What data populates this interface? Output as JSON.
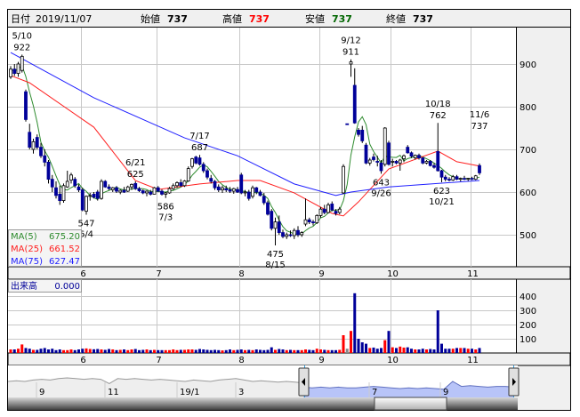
{
  "header": {
    "date_label": "日付",
    "date_value": "2019/11/07",
    "open_label": "始値",
    "open_value": "737",
    "high_label": "高値",
    "high_value": "737",
    "low_label": "安値",
    "low_value": "737",
    "close_label": "終値",
    "close_value": "737"
  },
  "legend": {
    "ma5": {
      "label": "MA(5)",
      "value": "675.20",
      "color": "#2e8b2e"
    },
    "ma25": {
      "label": "MA(25)",
      "value": "661.52",
      "color": "#ff2020"
    },
    "ma75": {
      "label": "MA(75)",
      "value": "627.47",
      "color": "#2020ff"
    },
    "volume": {
      "label": "出来高",
      "value": "0.000"
    }
  },
  "colors": {
    "up_volume": "#ff0000",
    "down_volume": "#000099",
    "flat_volume": "#888888",
    "down_body": "#000099",
    "up_body": "#ffffff",
    "grid": "#c8c8c8",
    "nav_fill": "#b8c4f8"
  },
  "chart_data": {
    "type": "candlestick",
    "price_axis": {
      "ticks": [
        "900",
        "800",
        "700",
        "600",
        "500"
      ],
      "range": [
        440,
        990
      ]
    },
    "volume_axis": {
      "ticks": [
        "400",
        "300",
        "200",
        "100"
      ],
      "range": [
        0,
        500
      ]
    },
    "month_labels": [
      {
        "date": "6/3",
        "label": "6"
      },
      {
        "date": "7/1",
        "label": "7"
      },
      {
        "date": "8/1",
        "label": "8"
      },
      {
        "date": "9/2",
        "label": "9"
      },
      {
        "date": "10/1",
        "label": "10"
      },
      {
        "date": "11/1",
        "label": "11"
      }
    ],
    "candles": [
      [
        "5/7",
        870,
        895,
        865,
        888,
        25
      ],
      [
        "5/8",
        888,
        900,
        872,
        878,
        25
      ],
      [
        "5/9",
        878,
        905,
        870,
        900,
        30
      ],
      [
        "5/10",
        885,
        922,
        880,
        918,
        60
      ],
      [
        "5/13",
        835,
        840,
        765,
        770,
        35
      ],
      [
        "5/14",
        740,
        760,
        700,
        705,
        30
      ],
      [
        "5/15",
        700,
        725,
        690,
        718,
        22
      ],
      [
        "5/16",
        728,
        735,
        700,
        705,
        22
      ],
      [
        "5/17",
        705,
        715,
        680,
        685,
        30
      ],
      [
        "5/20",
        685,
        700,
        660,
        670,
        35
      ],
      [
        "5/21",
        670,
        675,
        620,
        630,
        25
      ],
      [
        "5/22",
        630,
        640,
        600,
        612,
        30
      ],
      [
        "5/23",
        610,
        625,
        585,
        592,
        20
      ],
      [
        "5/24",
        595,
        615,
        570,
        580,
        25
      ],
      [
        "5/27",
        580,
        620,
        575,
        615,
        20
      ],
      [
        "5/28",
        612,
        650,
        610,
        625,
        20
      ],
      [
        "5/29",
        628,
        645,
        620,
        640,
        25
      ],
      [
        "5/30",
        630,
        635,
        610,
        615,
        20
      ],
      [
        "5/31",
        612,
        618,
        600,
        605,
        25
      ],
      [
        "6/3",
        605,
        610,
        555,
        558,
        30
      ],
      [
        "6/4",
        555,
        592,
        547,
        590,
        32
      ],
      [
        "6/5",
        590,
        598,
        580,
        592,
        28
      ],
      [
        "6/6",
        595,
        600,
        585,
        588,
        26
      ],
      [
        "6/7",
        600,
        605,
        580,
        585,
        28
      ],
      [
        "6/10",
        585,
        630,
        582,
        625,
        25
      ],
      [
        "6/11",
        625,
        628,
        610,
        612,
        22
      ],
      [
        "6/12",
        612,
        618,
        605,
        608,
        28
      ],
      [
        "6/13",
        605,
        612,
        600,
        610,
        25
      ],
      [
        "6/14",
        610,
        614,
        598,
        602,
        20
      ],
      [
        "6/17",
        600,
        606,
        595,
        604,
        22
      ],
      [
        "6/18",
        604,
        612,
        598,
        600,
        25
      ],
      [
        "6/19",
        602,
        615,
        600,
        612,
        20
      ],
      [
        "6/20",
        612,
        620,
        605,
        618,
        25
      ],
      [
        "6/21",
        620,
        625,
        605,
        608,
        28
      ],
      [
        "6/24",
        608,
        612,
        600,
        603,
        20
      ],
      [
        "6/25",
        603,
        606,
        595,
        598,
        22
      ],
      [
        "6/26",
        598,
        604,
        590,
        602,
        25
      ],
      [
        "6/27",
        600,
        605,
        592,
        595,
        20
      ],
      [
        "6/28",
        595,
        612,
        595,
        610,
        22
      ],
      [
        "7/1",
        610,
        614,
        600,
        602,
        20
      ],
      [
        "7/2",
        602,
        606,
        592,
        595,
        20
      ],
      [
        "7/3",
        595,
        600,
        586,
        598,
        20
      ],
      [
        "7/4",
        598,
        612,
        596,
        608,
        20
      ],
      [
        "7/5",
        608,
        620,
        605,
        615,
        25
      ],
      [
        "7/8",
        615,
        625,
        610,
        622,
        20
      ],
      [
        "7/9",
        622,
        630,
        612,
        615,
        22
      ],
      [
        "7/10",
        615,
        628,
        612,
        626,
        22
      ],
      [
        "7/11",
        626,
        660,
        624,
        655,
        25
      ],
      [
        "7/12",
        660,
        680,
        655,
        678,
        25
      ],
      [
        "7/16",
        682,
        685,
        665,
        668,
        22
      ],
      [
        "7/17",
        680,
        687,
        662,
        665,
        28
      ],
      [
        "7/18",
        665,
        670,
        645,
        650,
        25
      ],
      [
        "7/19",
        650,
        655,
        630,
        635,
        22
      ],
      [
        "7/22",
        632,
        640,
        620,
        625,
        20
      ],
      [
        "7/23",
        625,
        628,
        605,
        610,
        22
      ],
      [
        "7/24",
        612,
        618,
        600,
        605,
        20
      ],
      [
        "7/25",
        605,
        615,
        598,
        610,
        18
      ],
      [
        "7/26",
        608,
        615,
        600,
        605,
        20
      ],
      [
        "7/29",
        605,
        612,
        598,
        602,
        25
      ],
      [
        "7/30",
        602,
        610,
        596,
        608,
        20
      ],
      [
        "7/31",
        606,
        612,
        598,
        600,
        22
      ],
      [
        "8/1",
        640,
        645,
        595,
        598,
        25
      ],
      [
        "8/2",
        598,
        605,
        590,
        600,
        20
      ],
      [
        "8/5",
        600,
        605,
        580,
        585,
        22
      ],
      [
        "8/6",
        590,
        615,
        585,
        610,
        20
      ],
      [
        "8/7",
        610,
        612,
        595,
        600,
        25
      ],
      [
        "8/8",
        600,
        605,
        590,
        592,
        22
      ],
      [
        "8/9",
        590,
        598,
        570,
        575,
        20
      ],
      [
        "8/13",
        575,
        580,
        545,
        548,
        22
      ],
      [
        "8/14",
        555,
        560,
        510,
        515,
        40
      ],
      [
        "8/15",
        515,
        540,
        475,
        530,
        22
      ],
      [
        "8/16",
        530,
        545,
        500,
        505,
        28
      ],
      [
        "8/19",
        505,
        512,
        492,
        496,
        25
      ],
      [
        "8/20",
        496,
        505,
        490,
        500,
        20
      ],
      [
        "8/21",
        500,
        510,
        495,
        498,
        22
      ],
      [
        "8/22",
        498,
        515,
        490,
        510,
        20
      ],
      [
        "8/23",
        510,
        520,
        495,
        500,
        20
      ],
      [
        "8/26",
        500,
        508,
        495,
        505,
        20
      ],
      [
        "8/27",
        525,
        585,
        520,
        535,
        25
      ],
      [
        "8/28",
        535,
        540,
        525,
        530,
        22
      ],
      [
        "8/29",
        530,
        535,
        522,
        528,
        20
      ],
      [
        "8/30",
        528,
        548,
        525,
        545,
        30
      ],
      [
        "9/2",
        545,
        565,
        540,
        560,
        25
      ],
      [
        "9/3",
        560,
        570,
        548,
        552,
        22
      ],
      [
        "9/4",
        552,
        575,
        550,
        570,
        20
      ],
      [
        "9/5",
        572,
        578,
        555,
        558,
        20
      ],
      [
        "9/6",
        555,
        560,
        545,
        550,
        20
      ],
      [
        "9/9",
        552,
        565,
        548,
        560,
        22
      ],
      [
        "9/10",
        598,
        665,
        595,
        660,
        125
      ],
      [
        "9/11",
        760,
        760,
        760,
        760,
        30
      ],
      [
        "9/12",
        900,
        911,
        870,
        905,
        155
      ],
      [
        "9/13",
        850,
        890,
        760,
        762,
        420
      ],
      [
        "9/17",
        745,
        750,
        730,
        735,
        100
      ],
      [
        "9/18",
        745,
        755,
        715,
        720,
        75
      ],
      [
        "9/19",
        710,
        715,
        665,
        668,
        65
      ],
      [
        "9/20",
        668,
        680,
        662,
        675,
        35
      ],
      [
        "9/24",
        682,
        690,
        672,
        676,
        38
      ],
      [
        "9/25",
        672,
        685,
        660,
        670,
        30
      ],
      [
        "9/26",
        668,
        675,
        643,
        650,
        35
      ],
      [
        "9/27",
        665,
        752,
        660,
        750,
        90
      ],
      [
        "9/30",
        715,
        720,
        662,
        665,
        155
      ],
      [
        "10/1",
        670,
        678,
        660,
        672,
        40
      ],
      [
        "10/2",
        672,
        675,
        665,
        668,
        35
      ],
      [
        "10/3",
        668,
        678,
        650,
        675,
        45
      ],
      [
        "10/4",
        678,
        688,
        670,
        685,
        38
      ],
      [
        "10/7",
        705,
        710,
        690,
        692,
        40
      ],
      [
        "10/8",
        692,
        695,
        680,
        684,
        30
      ],
      [
        "10/9",
        680,
        688,
        676,
        686,
        25
      ],
      [
        "10/10",
        686,
        690,
        676,
        680,
        25
      ],
      [
        "10/11",
        680,
        682,
        665,
        668,
        30
      ],
      [
        "10/15",
        668,
        675,
        665,
        672,
        25
      ],
      [
        "10/16",
        672,
        675,
        660,
        662,
        28
      ],
      [
        "10/17",
        662,
        668,
        655,
        658,
        25
      ],
      [
        "10/18",
        695,
        762,
        648,
        650,
        300
      ],
      [
        "10/21",
        650,
        652,
        623,
        635,
        65
      ],
      [
        "10/23",
        635,
        640,
        625,
        630,
        30
      ],
      [
        "10/24",
        630,
        635,
        625,
        628,
        30
      ],
      [
        "10/25",
        628,
        640,
        626,
        636,
        30
      ],
      [
        "10/28",
        636,
        640,
        628,
        630,
        35
      ],
      [
        "10/29",
        630,
        634,
        625,
        632,
        35
      ],
      [
        "10/30",
        632,
        638,
        628,
        630,
        35
      ],
      [
        "10/31",
        630,
        633,
        626,
        632,
        30
      ],
      [
        "11/1",
        632,
        636,
        628,
        630,
        30
      ],
      [
        "11/5",
        630,
        640,
        628,
        638,
        25
      ],
      [
        "11/6",
        662,
        667,
        640,
        645,
        35
      ]
    ],
    "ma25_points": [
      [
        0,
        873
      ],
      [
        5,
        856
      ],
      [
        22,
        752
      ],
      [
        33,
        627
      ],
      [
        39,
        606
      ],
      [
        50,
        619
      ],
      [
        60,
        627
      ],
      [
        66,
        627
      ],
      [
        75,
        598
      ],
      [
        85,
        550
      ],
      [
        88,
        544
      ],
      [
        92,
        577
      ],
      [
        100,
        654
      ],
      [
        113,
        696
      ],
      [
        118,
        671
      ],
      [
        124,
        661
      ]
    ],
    "ma75_points": [
      [
        0,
        927
      ],
      [
        22,
        821
      ],
      [
        46,
        727
      ],
      [
        60,
        685
      ],
      [
        75,
        619
      ],
      [
        86,
        592
      ],
      [
        90,
        600
      ],
      [
        100,
        612
      ],
      [
        124,
        627
      ]
    ],
    "annotations": [
      {
        "date": "5/10",
        "value": "922",
        "pos": "above"
      },
      {
        "date": "6/4",
        "value": "547",
        "pos": "below"
      },
      {
        "date": "6/21",
        "value": "625",
        "pos": "above"
      },
      {
        "date": "7/3",
        "value": "586",
        "pos": "below"
      },
      {
        "date": "7/17",
        "value": "687",
        "pos": "above"
      },
      {
        "date": "8/15",
        "value": "475",
        "pos": "below"
      },
      {
        "date": "9/12",
        "value": "911",
        "pos": "above"
      },
      {
        "date": "9/26",
        "value": "643",
        "pos": "below"
      },
      {
        "date": "10/18",
        "value": "762",
        "pos": "above"
      },
      {
        "date": "10/21",
        "value": "623",
        "pos": "below"
      },
      {
        "date": "11/6",
        "value": "737",
        "pos": "above"
      }
    ]
  },
  "navigator": {
    "labels": [
      "9",
      "11",
      "19/1",
      "3",
      "7",
      "9"
    ],
    "history": [
      40,
      41,
      40,
      42,
      43,
      42,
      44,
      45,
      44,
      43,
      44,
      43,
      37,
      44,
      43,
      44,
      43,
      42,
      43,
      42,
      41,
      40,
      42,
      41,
      40,
      42,
      43,
      44,
      42,
      40,
      41,
      40,
      39,
      40,
      39,
      38
    ],
    "selected": [
      32,
      31,
      32,
      31,
      32,
      31,
      31,
      32,
      33,
      32,
      31,
      30,
      31,
      30,
      31,
      30,
      29,
      40,
      33,
      34,
      33,
      32,
      33,
      33,
      32
    ]
  }
}
